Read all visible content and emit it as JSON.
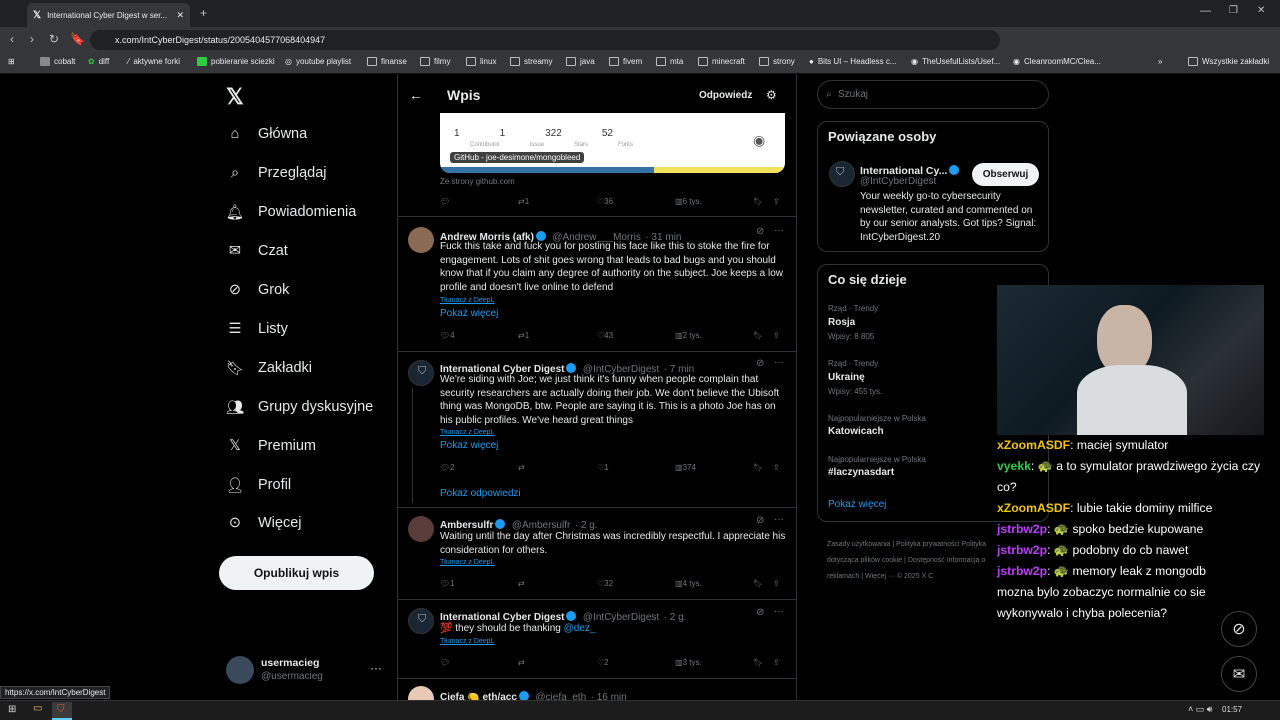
{
  "browser": {
    "tab_title": "International Cyber Digest w ser...",
    "url": "x.com/IntCyberDigest/status/2005404577068404947",
    "bookmarks": [
      "cobalt",
      "diff",
      "aktywne forki",
      "pobieranie sciezki",
      "youtube playlist",
      "finanse",
      "filmy",
      "linux",
      "streamy",
      "java",
      "fivem",
      "mta",
      "minecraft",
      "strony",
      "Bits UI – Headless c...",
      "TheUsefulLists/Usef...",
      "CleanroomMC/Clea..."
    ],
    "all_bookmarks": "Wszystkie zakładki",
    "status_url": "https://x.com/IntCyberDigest"
  },
  "nav": {
    "items": [
      "Główna",
      "Przeglądaj",
      "Powiadomienia",
      "Czat",
      "Grok",
      "Listy",
      "Zakładki",
      "Grupy dyskusyjne",
      "Premium",
      "Profil",
      "Więcej"
    ],
    "post_button": "Opublikuj wpis",
    "user_name": "usermacieg",
    "user_handle": "@usermacieg"
  },
  "header": {
    "title": "Wpis",
    "reply": "Odpowiedz"
  },
  "card": {
    "stats": [
      "1",
      "1",
      "322",
      "52"
    ],
    "stat_labels": [
      "Contributor",
      "Issue",
      "Stars",
      "Forks"
    ],
    "tag": "GitHub - joe-desimone/mongobleed",
    "source": "Ze strony github.com",
    "actions": {
      "retweets": "1",
      "likes": "36",
      "views": "6 tys."
    }
  },
  "tweets": [
    {
      "name": "Andrew Morris (afk)",
      "handle": "@Andrew___Morris",
      "time": "· 31 min",
      "text": "Fuck this take and fuck you for posting his face like this to stoke the fire for engagement. Lots of shit goes wrong that leads to bad bugs and you should know that if you claim any degree of authority on the subject. Joe keeps a low profile and doesn't live online to defend",
      "translate": "Tłumacz z DeepL",
      "more": "Pokaż więcej",
      "replies": "4",
      "retweets": "1",
      "likes": "43",
      "views": "2 tys."
    },
    {
      "name": "International Cyber Digest",
      "handle": "@IntCyberDigest",
      "time": "· 7 min",
      "text": "We're siding with Joe; we just think it's funny when people complain that security researchers are actually doing their job. We don't believe the Ubisoft thing was MongoDB, btw. People are saying it is. This is a photo Joe has on his public profiles. We've heard great things",
      "translate": "Tłumacz z DeepL",
      "more": "Pokaż więcej",
      "replies": "2",
      "retweets": "",
      "likes": "1",
      "views": "374",
      "show_replies": "Pokaż odpowiedzi"
    },
    {
      "name": "Ambersulfr",
      "handle": "@Ambersulfr",
      "time": "· 2 g.",
      "text": "Waiting until the day after Christmas was incredibly respectful. I appreciate his consideration for others.",
      "translate": "Tłumacz z DeepL",
      "replies": "1",
      "retweets": "",
      "likes": "32",
      "views": "4 tys."
    },
    {
      "name": "International Cyber Digest",
      "handle": "@IntCyberDigest",
      "time": "· 2 g.",
      "text_prefix": "💯 they should be thanking",
      "mention": "@dez_",
      "translate": "Tłumacz z DeepL",
      "replies": "",
      "retweets": "",
      "likes": "2",
      "views": "3 tys."
    },
    {
      "name": "Ciefa 🍋 eth/acc",
      "handle": "@ciefa_eth",
      "time": "· 16 min"
    }
  ],
  "search": {
    "placeholder": "Szukaj"
  },
  "related": {
    "title": "Powiązane osoby",
    "name": "International Cy...",
    "handle": "@IntCyberDigest",
    "follow": "Obserwuj",
    "bio": "Your weekly go-to cybersecurity newsletter, curated and commented on by our senior analysts. Got tips? Signal: IntCyberDigest.20"
  },
  "trends": {
    "title": "Co się dzieje",
    "items": [
      {
        "context": "Rząd · Trendy",
        "name": "Rosja",
        "count": "Wpisy: 8 805"
      },
      {
        "context": "Rząd · Trendy",
        "name": "Ukrainę",
        "count": "Wpisy: 455 tys."
      },
      {
        "context": "Najpopularniejsze w Polska",
        "name": "Katowicach",
        "count": ""
      },
      {
        "context": "Najpopularniejsze w Polska",
        "name": "#laczynasdart",
        "count": ""
      }
    ],
    "more": "Pokaż więcej"
  },
  "footer": [
    "Zasady użytkowania",
    "Polityka prywatności",
    "Polityka dotycząca plików cookie",
    "Dostępność",
    "Informacja o reklamach",
    "Więcej ···",
    "© 2025 X C"
  ],
  "chat": [
    {
      "user": "xZoomASDF",
      "color": "#f1c40f",
      "msg": ": maciej symulator"
    },
    {
      "user": "vyekk",
      "color": "#2ecc40",
      "msg": ": 🐢 a to symulator prawdziwego życia czy co?"
    },
    {
      "user": "xZoomASDF",
      "color": "#f1c40f",
      "msg": ": lubie takie dominy milfice"
    },
    {
      "user": "jstrbw2p",
      "color": "#c03cff",
      "msg": ": 🐢 spoko bedzie kupowane"
    },
    {
      "user": "jstrbw2p",
      "color": "#c03cff",
      "msg": ": 🐢 podobny do cb nawet"
    },
    {
      "user": "jstrbw2p",
      "color": "#c03cff",
      "msg": ": 🐢 memory leak z mongodb mozna bylo zobaczyc normalnie co sie wykonywalo i chyba polecenia?"
    }
  ],
  "taskbar": {
    "time": "01:57"
  }
}
